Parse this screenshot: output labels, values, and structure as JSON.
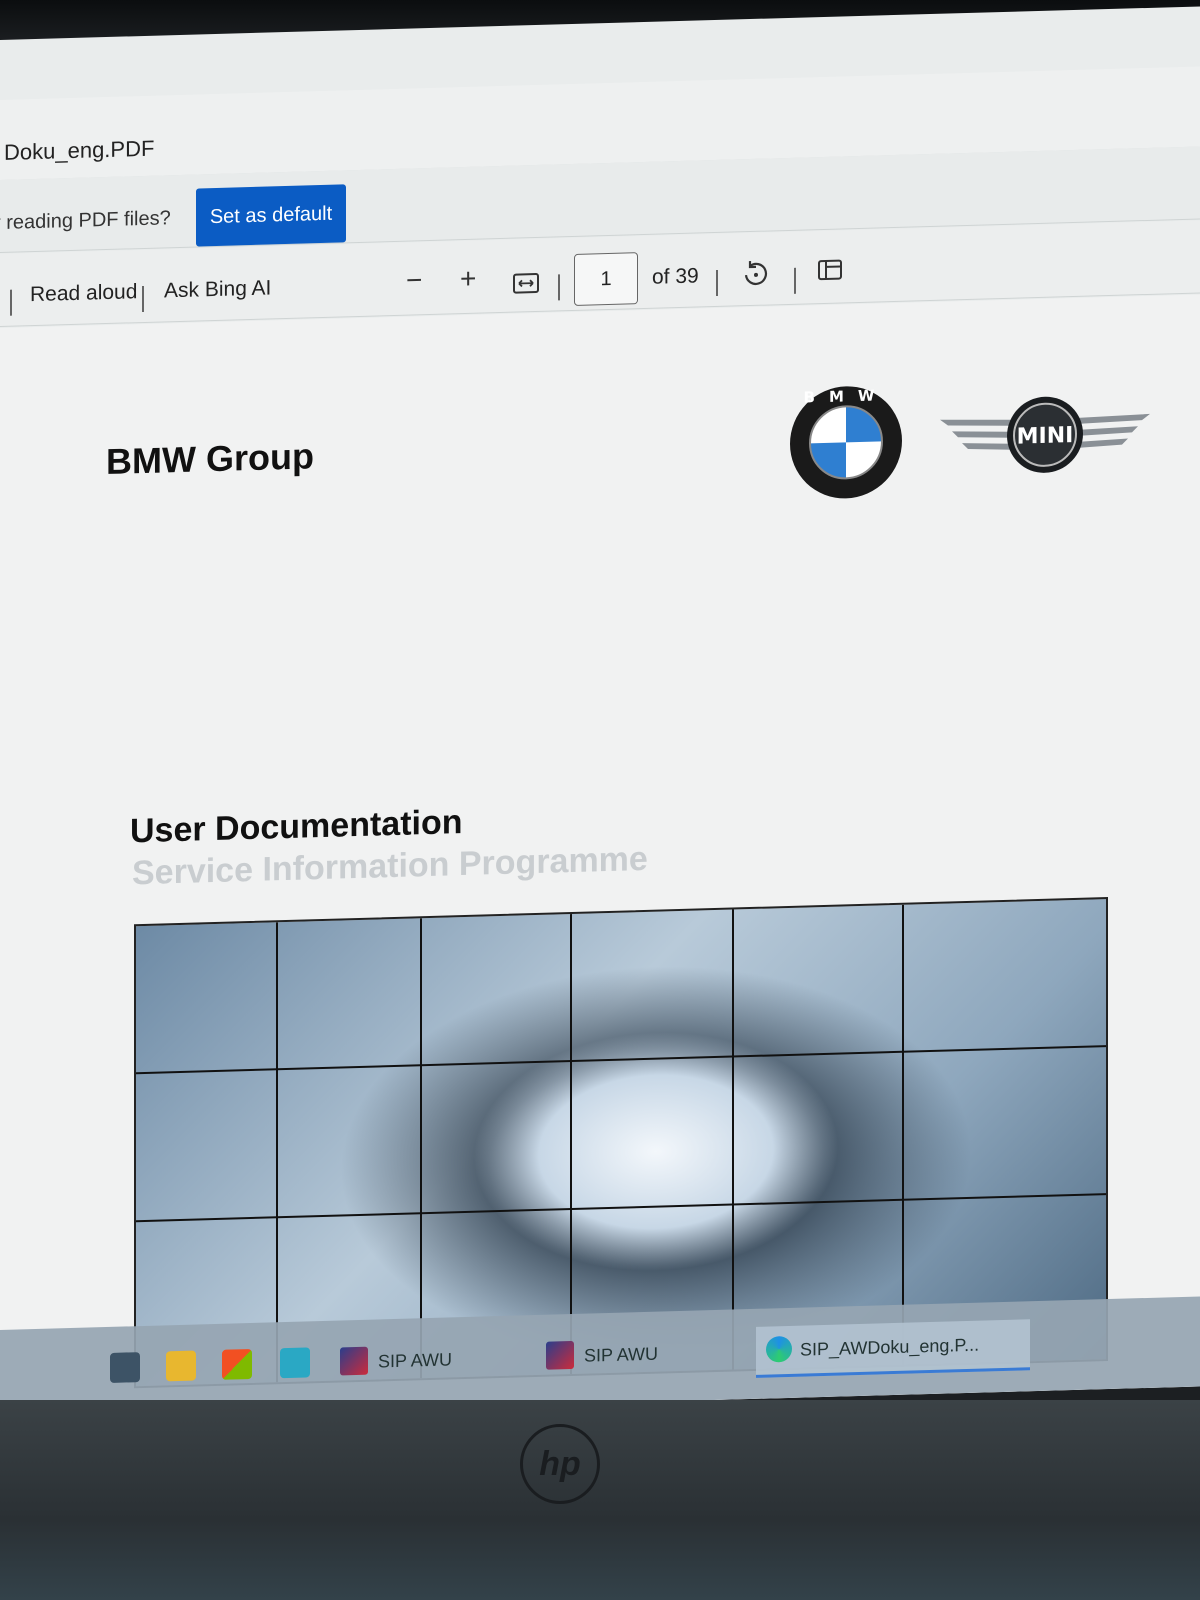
{
  "window": {
    "title": "Doku_eng.PDF"
  },
  "default_prompt": {
    "question": "r reading PDF files?",
    "button_label": "Set as default"
  },
  "toolbar": {
    "read_aloud": "Read aloud",
    "ask_bing": "Ask Bing AI",
    "zoom_out": "−",
    "zoom_in": "+",
    "page_current": "1",
    "page_total": "of 39"
  },
  "document": {
    "company": "BMW Group",
    "bmw_logo_text": "BMW",
    "mini_logo_text": "MINI",
    "title": "User Documentation",
    "subtitle": "Service Information Programme"
  },
  "taskbar": {
    "tasks": [
      {
        "label": "SIP AWU"
      },
      {
        "label": "SIP AWU"
      },
      {
        "label": "SIP_AWDoku_eng.P..."
      }
    ]
  },
  "colors": {
    "accent": "#0b5cc4"
  }
}
